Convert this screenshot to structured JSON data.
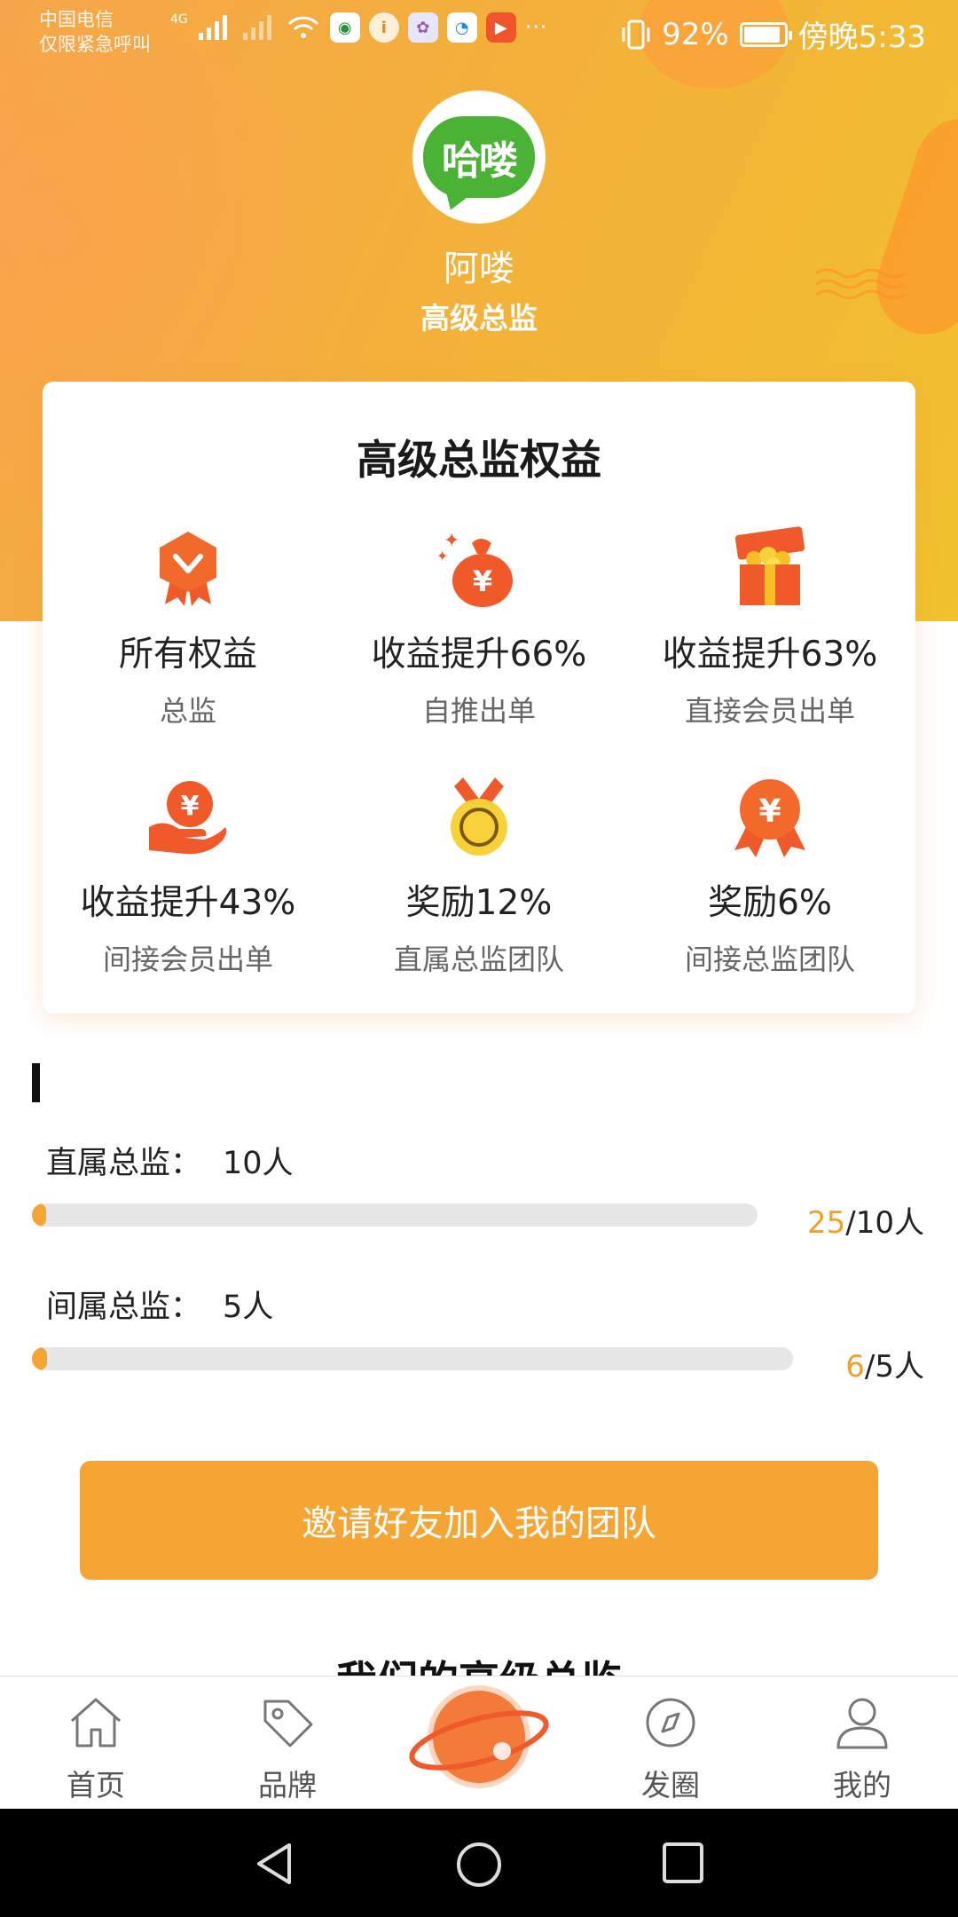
{
  "status_bar": {
    "carrier_line1": "中国电信",
    "carrier_line2": "仅限紧急呼叫",
    "network": "4G",
    "battery": "92%",
    "time": "傍晚5:33",
    "more": "···"
  },
  "profile": {
    "avatar_text": "哈喽",
    "name": "阿喽",
    "level": "高级总监"
  },
  "benefits": {
    "title": "高级总监权益",
    "items": [
      {
        "title": "所有权益",
        "sub": "总监",
        "icon": "badge-icon"
      },
      {
        "title": "收益提升66%",
        "sub": "自推出单",
        "icon": "money-bag-icon"
      },
      {
        "title": "收益提升63%",
        "sub": "直接会员出单",
        "icon": "gift-box-icon"
      },
      {
        "title": "收益提升43%",
        "sub": "间接会员出单",
        "icon": "hand-coin-icon"
      },
      {
        "title": "奖励12%",
        "sub": "直属总监团队",
        "icon": "medal-icon"
      },
      {
        "title": "奖励6%",
        "sub": "间接总监团队",
        "icon": "award-ribbon-icon"
      }
    ]
  },
  "progress": [
    {
      "label": "直属总监：",
      "value": "10人",
      "current": "25",
      "target": "/10人",
      "fraction": 0.02
    },
    {
      "label": "间属总监：",
      "value": "5人",
      "current": "6",
      "target": "/5人",
      "fraction": 0.01
    }
  ],
  "invite_button": "邀请好友加入我的团队",
  "next_section_title": "我们的高级总监",
  "tabs": [
    {
      "label": "首页",
      "icon": "home-icon"
    },
    {
      "label": "品牌",
      "icon": "tag-icon"
    },
    {
      "label": "",
      "icon": "planet-icon"
    },
    {
      "label": "发圈",
      "icon": "compass-icon"
    },
    {
      "label": "我的",
      "icon": "user-icon"
    }
  ],
  "colors": {
    "accent": "#f5a533",
    "hero": "#f3b03a",
    "icon_red": "#f05a2a"
  }
}
